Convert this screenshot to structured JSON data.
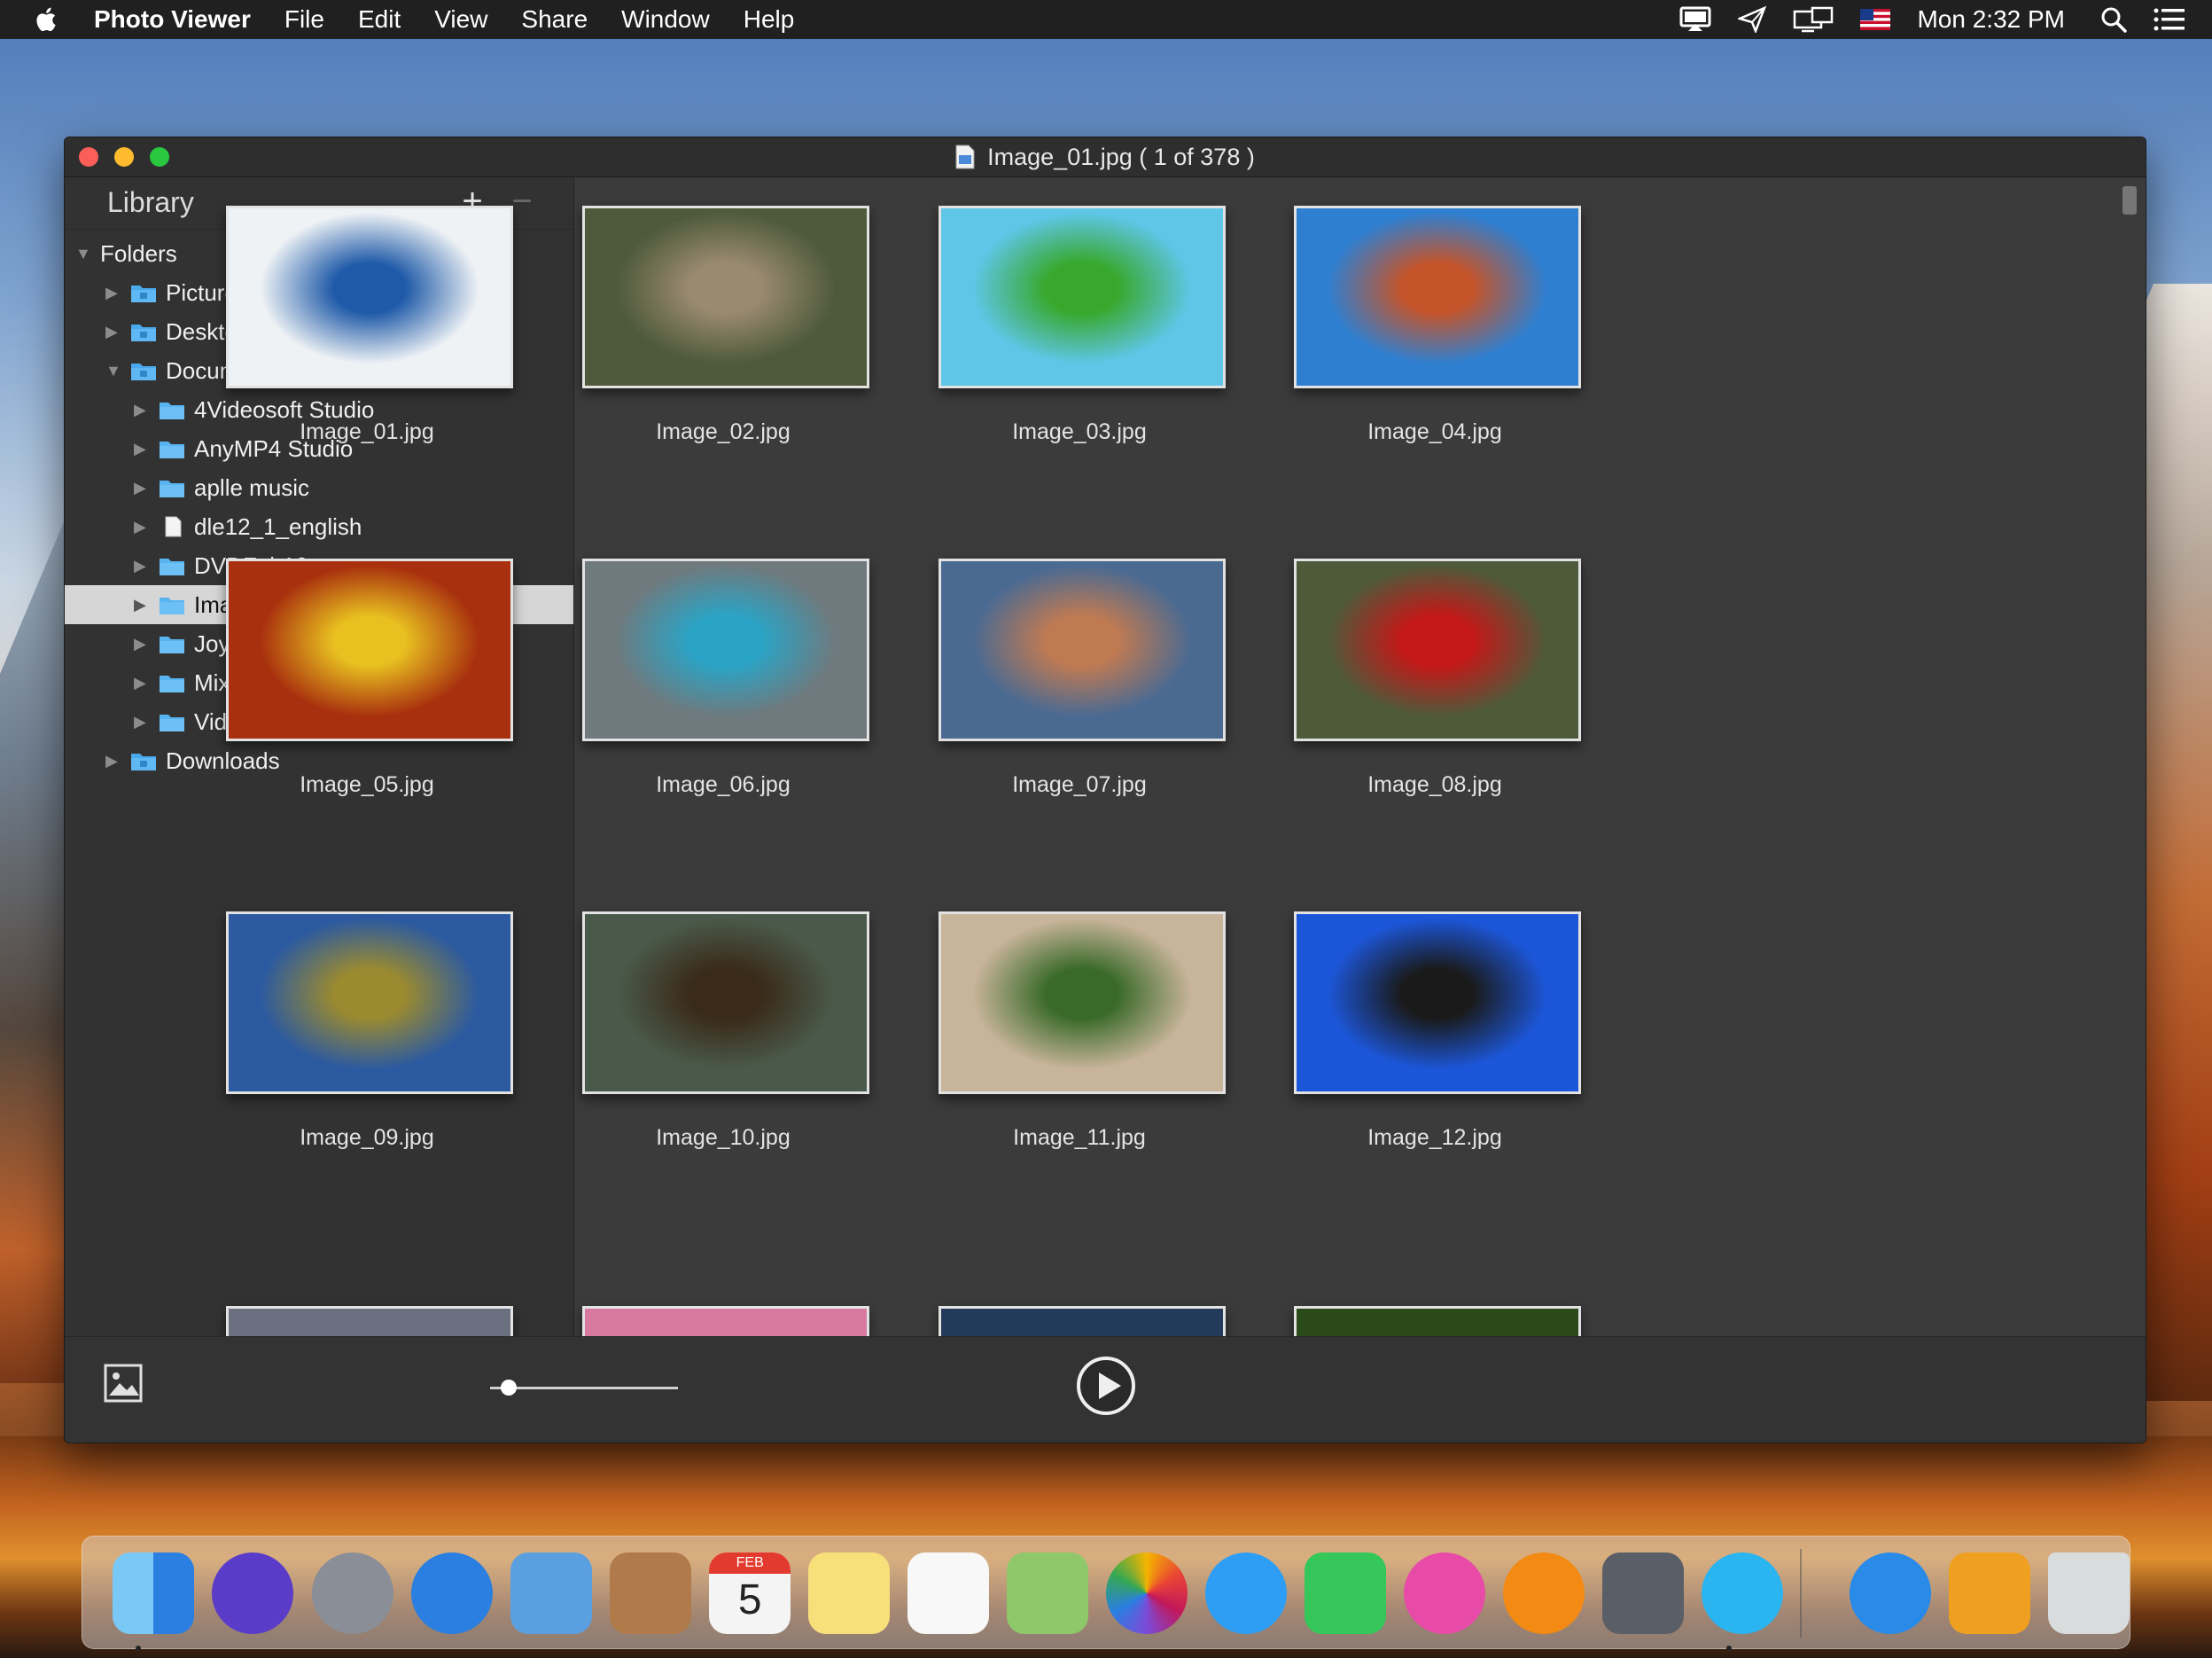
{
  "menubar": {
    "app_name": "Photo Viewer",
    "menus": [
      "File",
      "Edit",
      "View",
      "Share",
      "Window",
      "Help"
    ],
    "clock": "Mon 2:32 PM",
    "status_icons": [
      "airplay-display-icon",
      "send-icon",
      "display-mirror-icon",
      "us-flag-icon",
      "spotlight-search-icon",
      "notification-center-icon"
    ]
  },
  "window": {
    "title": "Image_01.jpg ( 1 of 378 )"
  },
  "sidebar": {
    "title": "Library",
    "add_label": "+",
    "remove_label": "−",
    "tree": [
      {
        "label": "Folders",
        "level": 0,
        "expanded": true,
        "kind": "header"
      },
      {
        "label": "Pictures",
        "level": 1,
        "expanded": false,
        "kind": "special-folder"
      },
      {
        "label": "Desktop",
        "level": 1,
        "expanded": false,
        "kind": "special-folder"
      },
      {
        "label": "Documents",
        "level": 1,
        "expanded": true,
        "kind": "special-folder"
      },
      {
        "label": "4Videosoft Studio",
        "level": 2,
        "expanded": false,
        "kind": "folder"
      },
      {
        "label": "AnyMP4 Studio",
        "level": 2,
        "expanded": false,
        "kind": "folder"
      },
      {
        "label": "aplle music",
        "level": 2,
        "expanded": false,
        "kind": "folder"
      },
      {
        "label": "dle12_1_english",
        "level": 2,
        "expanded": false,
        "kind": "file"
      },
      {
        "label": "DVDFab10",
        "level": 2,
        "expanded": false,
        "kind": "folder"
      },
      {
        "label": "Images",
        "level": 2,
        "expanded": false,
        "kind": "folder",
        "selected": true
      },
      {
        "label": "Joyoshare Media Cutter",
        "level": 2,
        "expanded": false,
        "kind": "folder"
      },
      {
        "label": "Mix 650",
        "level": 2,
        "expanded": false,
        "kind": "folder"
      },
      {
        "label": "VideoSolo Studio",
        "level": 2,
        "expanded": false,
        "kind": "folder"
      },
      {
        "label": "Downloads",
        "level": 1,
        "expanded": false,
        "kind": "special-folder"
      }
    ]
  },
  "gallery": {
    "images": [
      {
        "name": "Image_01.jpg",
        "bg": "#eef2f5",
        "accent": "#1f5aa8"
      },
      {
        "name": "Image_02.jpg",
        "bg": "#4f5a3c",
        "accent": "#9a8a70"
      },
      {
        "name": "Image_03.jpg",
        "bg": "#5fc6e8",
        "accent": "#38a82c"
      },
      {
        "name": "Image_04.jpg",
        "bg": "#2f7fd0",
        "accent": "#c4542a"
      },
      {
        "name": "Image_05.jpg",
        "bg": "#a8300e",
        "accent": "#e8c020"
      },
      {
        "name": "Image_06.jpg",
        "bg": "#6e7a7e",
        "accent": "#2aa4c6"
      },
      {
        "name": "Image_07.jpg",
        "bg": "#4a6a92",
        "accent": "#c07a52"
      },
      {
        "name": "Image_08.jpg",
        "bg": "#4e5a3a",
        "accent": "#c41818"
      },
      {
        "name": "Image_09.jpg",
        "bg": "#2c5aa0",
        "accent": "#9a8a30"
      },
      {
        "name": "Image_10.jpg",
        "bg": "#4a5a4a",
        "accent": "#3a2a1a"
      },
      {
        "name": "Image_11.jpg",
        "bg": "#c8b49a",
        "accent": "#3a6a2a"
      },
      {
        "name": "Image_12.jpg",
        "bg": "#1c56d8",
        "accent": "#1a1a1a"
      }
    ],
    "partial_row": [
      {
        "bg": "#6a7080"
      },
      {
        "bg": "#d87aa0"
      },
      {
        "bg": "#243a5a"
      },
      {
        "bg": "#2a4a1a"
      }
    ]
  },
  "toolbar": {
    "zoom_value": 0.1
  },
  "dock": {
    "apps": [
      {
        "name": "finder-icon",
        "color": "#3a8fe8"
      },
      {
        "name": "siri-icon",
        "color": "#5a3cc8"
      },
      {
        "name": "launchpad-icon",
        "color": "#8a8e96"
      },
      {
        "name": "safari-icon",
        "color": "#2a7fe0"
      },
      {
        "name": "mail-stamp-icon",
        "color": "#5aa0e0"
      },
      {
        "name": "contacts-icon",
        "color": "#b07a4a"
      },
      {
        "name": "calendar-icon",
        "color": "#f4f4f4"
      },
      {
        "name": "notes-icon",
        "color": "#f7e07a"
      },
      {
        "name": "reminders-icon",
        "color": "#f8f8f8"
      },
      {
        "name": "maps-icon",
        "color": "#8fc86a"
      },
      {
        "name": "photos-icon",
        "color": "#f0f0f0"
      },
      {
        "name": "messages-icon",
        "color": "#2e9ef4"
      },
      {
        "name": "facetime-icon",
        "color": "#35c759"
      },
      {
        "name": "itunes-icon",
        "color": "#e84aa8"
      },
      {
        "name": "ibooks-icon",
        "color": "#f28a14"
      },
      {
        "name": "system-preferences-icon",
        "color": "#5a5e66"
      },
      {
        "name": "photo-viewer-icon",
        "color": "#2ab4f0"
      },
      {
        "name": "reeder-icon",
        "color": "#2a8ae8"
      },
      {
        "name": "folder-sigma-icon",
        "color": "#f0a020"
      },
      {
        "name": "trash-icon",
        "color": "#d8dcdc"
      }
    ],
    "calendar_month": "FEB",
    "calendar_day": "5"
  }
}
